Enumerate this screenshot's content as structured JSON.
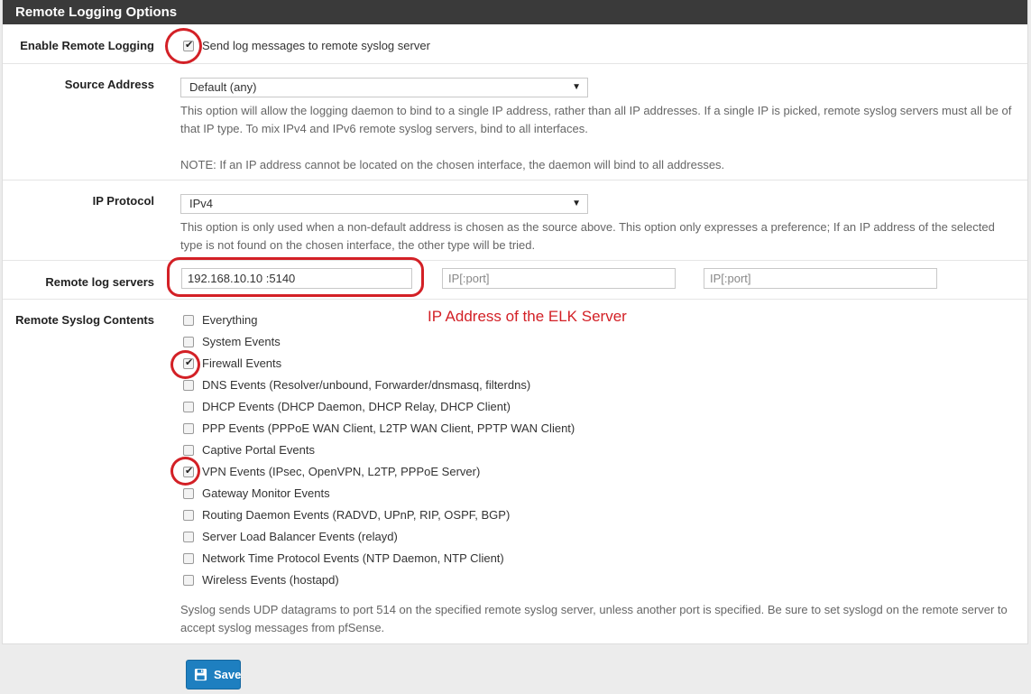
{
  "panel": {
    "title": "Remote Logging Options"
  },
  "enable": {
    "label": "Enable Remote Logging",
    "checked": true,
    "text": "Send log messages to remote syslog server"
  },
  "source": {
    "label": "Source Address",
    "value": "Default (any)",
    "help1": "This option will allow the logging daemon to bind to a single IP address, rather than all IP addresses. If a single IP is picked, remote syslog servers must all be of that IP type. To mix IPv4 and IPv6 remote syslog servers, bind to all interfaces.",
    "note": "NOTE: If an IP address cannot be located on the chosen interface, the daemon will bind to all addresses."
  },
  "protocol": {
    "label": "IP Protocol",
    "value": "IPv4",
    "help": "This option is only used when a non-default address is chosen as the source above. This option only expresses a preference; If an IP address of the selected type is not found on the chosen interface, the other type will be tried."
  },
  "servers": {
    "label": "Remote log servers",
    "server1": "192.168.10.10 :5140",
    "placeholder": "IP[:port]",
    "annotation": "IP Address of the ELK Server"
  },
  "contents": {
    "label": "Remote Syslog Contents",
    "items": [
      {
        "label": "Everything",
        "checked": false
      },
      {
        "label": "System Events",
        "checked": false
      },
      {
        "label": "Firewall Events",
        "checked": true
      },
      {
        "label": "DNS Events (Resolver/unbound, Forwarder/dnsmasq, filterdns)",
        "checked": false
      },
      {
        "label": "DHCP Events (DHCP Daemon, DHCP Relay, DHCP Client)",
        "checked": false
      },
      {
        "label": "PPP Events (PPPoE WAN Client, L2TP WAN Client, PPTP WAN Client)",
        "checked": false
      },
      {
        "label": "Captive Portal Events",
        "checked": false
      },
      {
        "label": "VPN Events (IPsec, OpenVPN, L2TP, PPPoE Server)",
        "checked": true
      },
      {
        "label": "Gateway Monitor Events",
        "checked": false
      },
      {
        "label": "Routing Daemon Events (RADVD, UPnP, RIP, OSPF, BGP)",
        "checked": false
      },
      {
        "label": "Server Load Balancer Events (relayd)",
        "checked": false
      },
      {
        "label": "Network Time Protocol Events (NTP Daemon, NTP Client)",
        "checked": false
      },
      {
        "label": "Wireless Events (hostapd)",
        "checked": false
      }
    ],
    "help": "Syslog sends UDP datagrams to port 514 on the specified remote syslog server, unless another port is specified. Be sure to set syslogd on the remote server to accept syslog messages from pfSense."
  },
  "save": {
    "label": "Save",
    "icon": "floppy-disk-icon"
  },
  "colors": {
    "header": "#3a3a3a",
    "primary": "#1e7fc0",
    "annotation": "#d32026"
  }
}
